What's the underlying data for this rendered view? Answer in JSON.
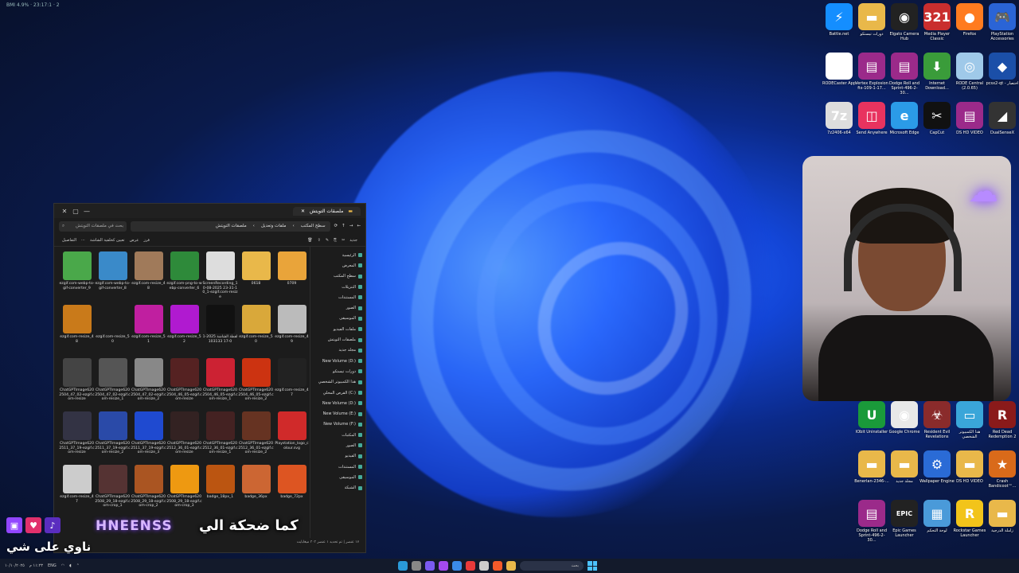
{
  "status_top": "BMI 4.9% · 23:17:1 · 2",
  "desktop_icons_top": [
    {
      "label": "Battle.net",
      "icon": "battlenet-icon",
      "color": "#148eff",
      "glyph": "⚡"
    },
    {
      "label": "دورات تيستكو",
      "icon": "folder-icon",
      "color": "#e9b84a",
      "glyph": "▬"
    },
    {
      "label": "Elgato Camera Hub",
      "icon": "camera-icon",
      "color": "#222",
      "glyph": "◉"
    },
    {
      "label": "Media Player Classic",
      "icon": "media-player-icon",
      "color": "#c92e2e",
      "glyph": "321"
    },
    {
      "label": "Firefox",
      "icon": "firefox-icon",
      "color": "#ff7b1f",
      "glyph": "●"
    },
    {
      "label": "PlayStation Accessories",
      "icon": "playstation-icon",
      "color": "#2a64d6",
      "glyph": "🎮"
    },
    {
      "label": "RODECaster App",
      "icon": "rode-icon",
      "color": "#fff",
      "glyph": "R"
    },
    {
      "label": "Vertex Explosion fix-109-1-17...",
      "icon": "winrar-icon",
      "color": "#9b2a8a",
      "glyph": "▤"
    },
    {
      "label": "Dodge Roll and Sprint-496-2-30...",
      "icon": "winrar-icon",
      "color": "#9b2a8a",
      "glyph": "▤"
    },
    {
      "label": "Internet Download...",
      "icon": "internet-download-icon",
      "color": "#3a9c3a",
      "glyph": "⬇"
    },
    {
      "label": "RODE Central (2.0.65)",
      "icon": "rode-central-icon",
      "color": "#9fc9e9",
      "glyph": "◎"
    },
    {
      "label": "pcsx2-qt - اختصار",
      "icon": "pcsx2-icon",
      "color": "#1b4fa8",
      "glyph": "◆"
    },
    {
      "label": "7z2406-x64",
      "icon": "7zip-icon",
      "color": "#ddd",
      "glyph": "7z"
    },
    {
      "label": "Send Anywhere",
      "icon": "send-anywhere-icon",
      "color": "#e8335f",
      "glyph": "◫"
    },
    {
      "label": "Microsoft Edge",
      "icon": "edge-icon",
      "color": "#2b9be8",
      "glyph": "e"
    },
    {
      "label": "CapCut",
      "icon": "capcut-icon",
      "color": "#111",
      "glyph": "✂"
    },
    {
      "label": "DS HD VIDEO",
      "icon": "winrar-icon",
      "color": "#9b2a8a",
      "glyph": "▤"
    },
    {
      "label": "DualSenseX",
      "icon": "dualsense-icon",
      "color": "#333",
      "glyph": "◢"
    }
  ],
  "desktop_icons_bottom": [
    {
      "label": "IObit Uninstaller",
      "icon": "iobit-icon",
      "color": "#1a9a3a",
      "glyph": "U"
    },
    {
      "label": "Google Chrome",
      "icon": "chrome-icon",
      "color": "#e8e8e8",
      "glyph": "◉"
    },
    {
      "label": "Resident Evil Revelations",
      "icon": "resident-evil-icon",
      "color": "#8a2b2b",
      "glyph": "☣"
    },
    {
      "label": "هذا الكمبيوتر الشخصي",
      "icon": "this-pc-icon",
      "color": "#3aa6d9",
      "glyph": "▭"
    },
    {
      "label": "Red Dead Redemption 2",
      "icon": "rdr2-icon",
      "color": "#8a1a1a",
      "glyph": "R"
    },
    {
      "label": "Benerlan-2346-...",
      "icon": "folder-icon",
      "color": "#e9b84a",
      "glyph": "▬"
    },
    {
      "label": "مجلد جديد",
      "icon": "folder-icon",
      "color": "#e9b84a",
      "glyph": "▬"
    },
    {
      "label": "Wallpaper Engine",
      "icon": "wallpaper-engine-icon",
      "color": "#2a6bd6",
      "glyph": "⚙"
    },
    {
      "label": "DS HD VIDEO",
      "icon": "folder-icon",
      "color": "#e9b84a",
      "glyph": "▬"
    },
    {
      "label": "Crash Bandicoot™...",
      "icon": "crash-bandicoot-icon",
      "color": "#d96a1a",
      "glyph": "★"
    },
    {
      "label": "Dodge Roll and Sprint-496-2-30...",
      "icon": "winrar-icon",
      "color": "#9b2a8a",
      "glyph": "▤"
    },
    {
      "label": "Epic Games Launcher",
      "icon": "epic-games-icon",
      "color": "#222",
      "glyph": "EPIC"
    },
    {
      "label": "لوحة التحكم",
      "icon": "control-panel-icon",
      "color": "#4a9ad9",
      "glyph": "▦"
    },
    {
      "label": "Rockstar Games Launcher",
      "icon": "rockstar-icon",
      "color": "#f2c41a",
      "glyph": "R"
    },
    {
      "label": "زاملة الدرجية",
      "icon": "folder-icon",
      "color": "#e9b84a",
      "glyph": "▬"
    }
  ],
  "explorer": {
    "tab_title": "ملصقات التويتش",
    "search_placeholder": "بحث في ملصقات التويتش",
    "breadcrumb": [
      "سطح المكتب",
      "ملفات وتعديل",
      "ملصقات التويتش"
    ],
    "toolbar": [
      "جديد",
      "فرز",
      "عرض",
      "تعيين كخلفية الشاشة",
      "التفاصيل"
    ],
    "nav": [
      "الرئيسية",
      "المعرض",
      "سطح المكتب",
      "التنزيلات",
      "المستندات",
      "الصور",
      "الموسيقى",
      "ملفات الفيديو",
      "ملصقات التويتش",
      "مجلد جديد",
      "New Volume (D:)",
      "دورات تيستكو",
      "هذا الكمبيوتر الشخصي",
      "القرص المحلي (C:)",
      "New Volume (D:)",
      "New Volume (E:)",
      "New Volume (F:)",
      "المكتبات",
      "الصور",
      "الفيديو",
      "المستندات",
      "الموسيقى",
      "الشبكة"
    ],
    "files": [
      {
        "name": "ezgif.com-webp-to-gif-converter_9",
        "color": "#4aa84a"
      },
      {
        "name": "ezgif.com-webp-to-gif-converter_8",
        "color": "#3a8ac9"
      },
      {
        "name": "ezgif.com-resize_48",
        "color": "#a07a5a"
      },
      {
        "name": "ezgif.com-png-to-webp-converter_6",
        "color": "#2e8a3a"
      },
      {
        "name": "ScreenRecording_10-08-2025 23-31-10_1-ezgif.com-resize",
        "color": "#ddd"
      },
      {
        "name": "0618",
        "color": "#e9b84a"
      },
      {
        "name": "0709",
        "color": "#e9a43a"
      },
      {
        "name": "ezgif.com-resize_48",
        "color": "#c97a1a"
      },
      {
        "name": "ezgif.com-resize_50",
        "color": "#1c1c1c"
      },
      {
        "name": "ezgif.com-resize_51",
        "color": "#c01fa0"
      },
      {
        "name": "ezgif.com-resize_52",
        "color": "#b01ad0"
      },
      {
        "name": "لقطة الشاشة 2025-10-17 103133",
        "color": "#111"
      },
      {
        "name": "ezgif.com-resize_50",
        "color": "#d9a83a"
      },
      {
        "name": "ezgif.com-resize_49",
        "color": "#bbb"
      },
      {
        "name": "ChatGPTImage6202504_47_02-ezgif.com-resize",
        "color": "#444"
      },
      {
        "name": "ChatGPTImage6202504_47_02-ezgif.com-resize_1",
        "color": "#555"
      },
      {
        "name": "ChatGPTImage6202504_47_02-ezgif.com-resize_2",
        "color": "#888"
      },
      {
        "name": "ChatGPTImage6202504_46_05-ezgif.com-resize",
        "color": "#522"
      },
      {
        "name": "ChatGPTImage6202504_46_05-ezgif.com-resize_1",
        "color": "#c23"
      },
      {
        "name": "ChatGPTImage6202504_46_05-ezgif.com-resize_2",
        "color": "#c31"
      },
      {
        "name": "ezgif.com-resize_47",
        "color": "#222"
      },
      {
        "name": "ChatGPTImage6202511_37_19-ezgif.com-resize",
        "color": "#334"
      },
      {
        "name": "ChatGPTImage6202511_37_19-ezgif.com-resize_2",
        "color": "#2a4aa8"
      },
      {
        "name": "ChatGPTImage6202511_37_19-ezgif.com-resize_3",
        "color": "#1f4ad0"
      },
      {
        "name": "ChatGPTImage6202512_36_01-ezgif.com-resize",
        "color": "#322"
      },
      {
        "name": "ChatGPTImage6202512_36_01-ezgif.com-resize_1",
        "color": "#422"
      },
      {
        "name": "ChatGPTImage6202512_36_01-ezgif.com-resize_2",
        "color": "#632"
      },
      {
        "name": "Playstation_logo_colour.svg",
        "color": "#d02a2a"
      },
      {
        "name": "ezgif.com-resize_47",
        "color": "#ccc"
      },
      {
        "name": "ChatGPTImage6202508_29_18-ezgif.com-crop_1",
        "color": "#533"
      },
      {
        "name": "ChatGPTImage6202508_29_18-ezgif.com-crop_2",
        "color": "#a52"
      },
      {
        "name": "ChatGPTImage6202508_29_18-ezgif.com-crop_3",
        "color": "#e91"
      },
      {
        "name": "badge_18px_1",
        "color": "#b51"
      },
      {
        "name": "badge_36px",
        "color": "#c63"
      },
      {
        "name": "badge_72px",
        "color": "#d52"
      }
    ],
    "status": "١٧ عنصر | تم تحديد ١ عنصر ٣٠٣ ميغابايت"
  },
  "overlay": {
    "name": "HNEENSS",
    "caption_1": "كما ضحكة الي",
    "caption_2": "ناوي على شي"
  },
  "taskbar": {
    "search": "بحث",
    "tray": [
      "ENG",
      "١١:٢٣ م",
      "١٠/١٠/٢٠٢٥"
    ]
  }
}
